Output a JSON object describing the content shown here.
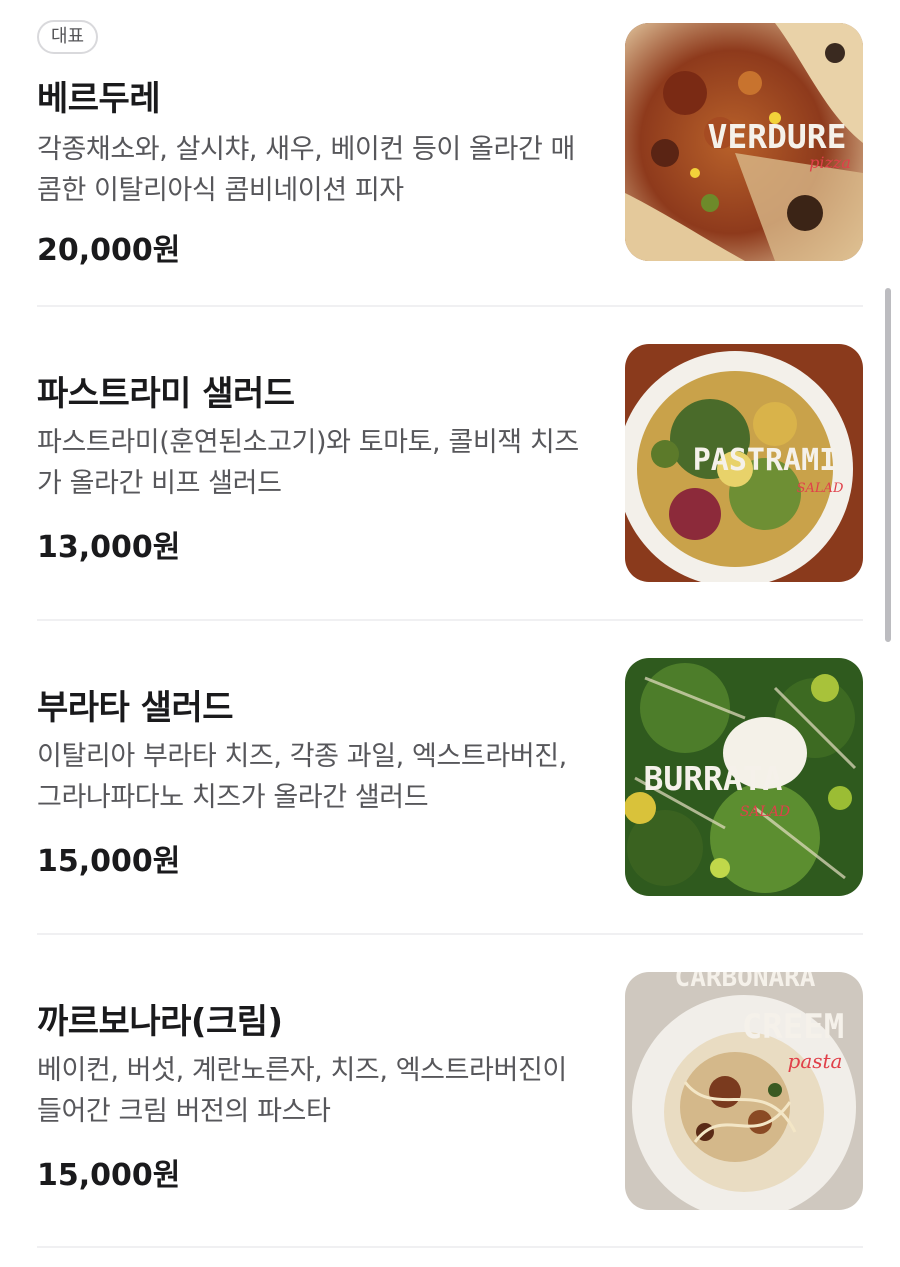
{
  "menu": {
    "items": [
      {
        "badge": "대표",
        "name": "베르두레",
        "description": "각종채소와, 살시챠, 새우, 베이컨 등이 올라간 매콤한 이탈리아식 콤비네이션 피자",
        "price": "20,000원",
        "image_title": "VERDURE",
        "image_subtitle": "pizza"
      },
      {
        "name": "파스트라미 샐러드",
        "description": "파스트라미(훈연된소고기)와 토마토, 콜비잭 치즈가 올라간 비프 샐러드",
        "price": "13,000원",
        "image_title": "PASTRAMI",
        "image_subtitle": "SALAD"
      },
      {
        "name": "부라타 샐러드",
        "description": "이탈리아 부라타 치즈, 각종 과일, 엑스트라버진, 그라나파다노 치즈가 올라간 샐러드",
        "price": "15,000원",
        "image_title": "BURRATA",
        "image_subtitle": "SALAD"
      },
      {
        "name": "까르보나라(크림)",
        "description": "베이컨, 버섯, 계란노른자, 치즈, 엑스트라버진이 들어간 크림 버전의 파스타",
        "price": "15,000원",
        "image_title_top": "CARBONARA",
        "image_title": "CREEM",
        "image_subtitle": "pasta"
      }
    ]
  },
  "colors": {
    "text_primary": "#1a1a1c",
    "text_secondary": "#57575b",
    "divider": "#f0f0f2",
    "badge_border": "#d9d9dc",
    "image_subtitle": "#e0404a"
  }
}
